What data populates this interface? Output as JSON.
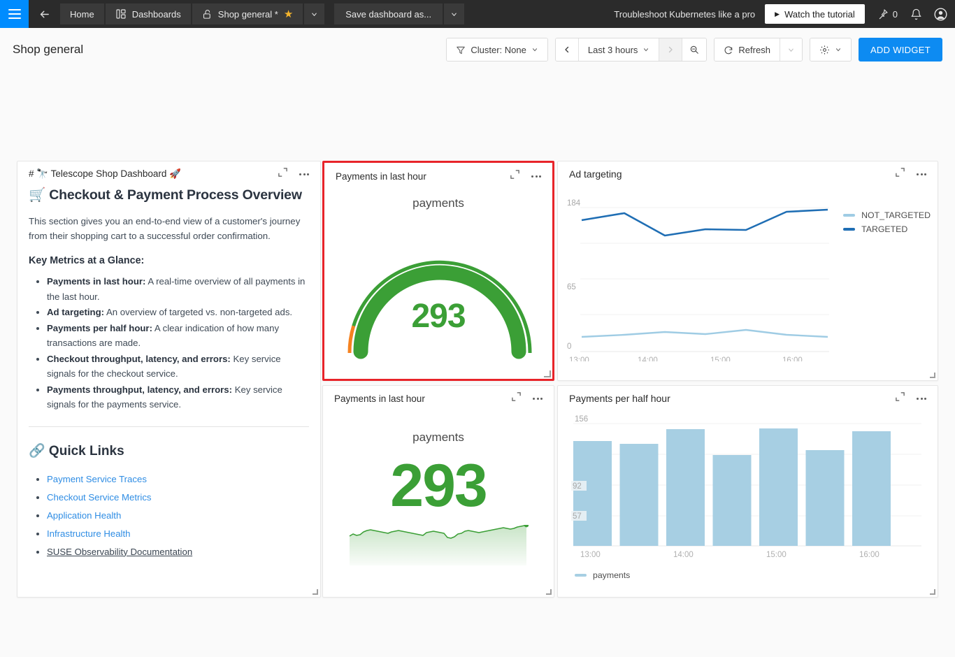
{
  "topbar": {
    "hamburger": "menu-icon",
    "back": "back-arrow-icon",
    "home_label": "Home",
    "dashboards_label": "Dashboards",
    "dashboard_label": "Shop general *",
    "save_as_label": "Save dashboard as...",
    "tutorial_text": "Troubleshoot Kubernetes like a pro",
    "watch_label": "Watch the tutorial",
    "pin_count": "0",
    "chevron": "⌄"
  },
  "subheader": {
    "title": "Shop general",
    "cluster_label": "Cluster: None",
    "time_range_label": "Last 3 hours",
    "refresh_label": "Refresh",
    "add_widget_label": "ADD WIDGET"
  },
  "colors": {
    "accent_blue": "#0d8bf2",
    "brand_blue": "#008cff",
    "selected_red": "#e8242a",
    "green": "#3b9f36",
    "orange": "#f58220",
    "line_dark": "#1f6eb4",
    "line_light": "#9fcce4",
    "bar_blue": "#a7cfe3",
    "star_gold": "#f5b52c"
  },
  "markdown_card": {
    "title": "# 🔭 Telescope Shop Dashboard 🚀",
    "heading": "🛒 Checkout & Payment Process Overview",
    "paragraph": "This section gives you an end-to-end view of a customer's journey from their shopping cart to a successful order confirmation.",
    "metrics_heading": "Key Metrics at a Glance:",
    "metrics": [
      {
        "term": "Payments in last hour:",
        "desc": " A real-time overview of all payments in the last hour."
      },
      {
        "term": "Ad targeting:",
        "desc": " An overview of targeted vs. non-targeted ads."
      },
      {
        "term": "Payments per half hour:",
        "desc": " A clear indication of how many transactions are made."
      },
      {
        "term": "Checkout throughput, latency, and errors:",
        "desc": " Key service signals for the checkout service."
      },
      {
        "term": "Payments throughput, latency, and errors:",
        "desc": " Key service signals for the payments service."
      }
    ],
    "links_heading": "🔗 Quick Links",
    "links": [
      "Payment Service Traces",
      "Checkout Service Metrics",
      "Application Health",
      "Infrastructure Health",
      "SUSE Observability Documentation"
    ]
  },
  "gauge_card": {
    "title": "Payments in last hour",
    "unit": "payments",
    "value": "293"
  },
  "bignum_card": {
    "title": "Payments in last hour",
    "unit": "payments",
    "value": "293"
  },
  "ad_targeting_card": {
    "title": "Ad targeting"
  },
  "payments_half_hour_card": {
    "title": "Payments per half hour"
  },
  "chart_data": [
    {
      "type": "line",
      "title": "Ad targeting",
      "xlabel": "",
      "ylabel": "",
      "grid": true,
      "legend_position": "right",
      "ylim": [
        0,
        205
      ],
      "yticks": [
        0,
        65,
        184
      ],
      "ytick_labels": [
        "0",
        "65",
        "184"
      ],
      "x": [
        "13:00",
        "13:30",
        "14:00",
        "14:30",
        "15:00",
        "15:30",
        "16:00"
      ],
      "xtick_labels": [
        "13:00",
        "14:00",
        "15:00",
        "16:00"
      ],
      "series": [
        {
          "name": "TARGETED",
          "color": "#1f6eb4",
          "values": [
            168,
            177,
            148,
            157,
            156,
            179,
            181
          ]
        },
        {
          "name": "NOT_TARGETED",
          "color": "#9fcce4",
          "values": [
            19,
            21,
            25,
            22,
            28,
            21,
            19
          ]
        }
      ]
    },
    {
      "type": "bar",
      "title": "Payments per half hour",
      "xlabel": "",
      "ylabel": "",
      "grid": true,
      "legend_position": "bottom",
      "ylim": [
        0,
        156
      ],
      "yticks": [
        57,
        92,
        156
      ],
      "ytick_labels": [
        "57",
        "92",
        "156"
      ],
      "categories": [
        "13:00",
        "13:30",
        "14:00",
        "14:30",
        "15:00",
        "15:30",
        "16:00"
      ],
      "xtick_labels": [
        "13:00",
        "14:00",
        "15:00",
        "16:00"
      ],
      "values": [
        134,
        130,
        149,
        116,
        150,
        122,
        146
      ],
      "series": [
        {
          "name": "payments",
          "color": "#a7cfe3",
          "values": [
            134,
            130,
            149,
            116,
            150,
            122,
            146
          ]
        }
      ]
    },
    {
      "type": "gauge",
      "title": "Payments in last hour",
      "unit": "payments",
      "value": 293,
      "ring_colors": {
        "value_arc": "#3b9f36",
        "threshold_low": "#f58220"
      }
    },
    {
      "type": "area",
      "title": "Payments in last hour",
      "unit": "payments",
      "value": 293,
      "color": "#3b9f36",
      "sparkline": [
        262,
        268,
        264,
        266,
        272,
        276,
        278,
        276,
        274,
        272,
        270,
        268,
        272,
        274,
        276,
        274,
        272,
        270,
        268,
        266,
        264,
        262,
        268,
        270,
        272,
        270,
        268,
        266,
        258,
        256,
        260,
        266,
        268,
        272,
        274,
        272,
        270,
        268,
        270,
        272,
        274,
        276,
        278,
        280,
        282,
        280,
        278,
        280,
        284,
        286,
        288,
        290,
        292,
        293
      ]
    }
  ]
}
